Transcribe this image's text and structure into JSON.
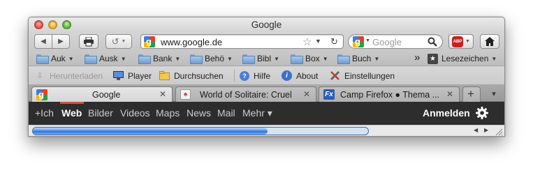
{
  "window": {
    "title": "Google"
  },
  "navbar": {
    "url": "www.google.de",
    "search_placeholder": "Google",
    "adblock_label": "ABP"
  },
  "bookmarks": {
    "items": [
      {
        "label": "Auk"
      },
      {
        "label": "Ausk"
      },
      {
        "label": "Bank"
      },
      {
        "label": "Behö"
      },
      {
        "label": "Bibl"
      },
      {
        "label": "Box"
      },
      {
        "label": "Buch"
      }
    ],
    "overflow": "»",
    "lesezeichen_label": "Lesezeichen"
  },
  "addons": {
    "items": [
      {
        "label": "Herunterladen",
        "enabled": false,
        "icon": "download-icon"
      },
      {
        "label": "Player",
        "enabled": true,
        "icon": "monitor-icon"
      },
      {
        "label": "Durchsuchen",
        "enabled": true,
        "icon": "folder-search-icon"
      },
      {
        "label": "Hilfe",
        "enabled": true,
        "icon": "help-icon"
      },
      {
        "label": "About",
        "enabled": true,
        "icon": "info-icon"
      },
      {
        "label": "Einstellungen",
        "enabled": true,
        "icon": "tools-icon"
      }
    ]
  },
  "tabs": {
    "items": [
      {
        "label": "Google",
        "active": true,
        "icon": "google-favicon"
      },
      {
        "label": "World of Solitaire: Cruel",
        "active": false,
        "icon": "solitaire-favicon"
      },
      {
        "label": "Camp Firefox ● Thema ...",
        "active": false,
        "icon": "firefox-fx-favicon"
      }
    ],
    "new_tab": "+",
    "list_tabs": "▾"
  },
  "google_bar": {
    "links": [
      {
        "label": "+Ich"
      },
      {
        "label": "Web",
        "selected": true
      },
      {
        "label": "Bilder"
      },
      {
        "label": "Videos"
      },
      {
        "label": "Maps"
      },
      {
        "label": "News"
      },
      {
        "label": "Mail"
      },
      {
        "label": "Mehr ▾"
      }
    ],
    "signin": "Anmelden"
  },
  "status": {
    "progress": 0.7
  },
  "colors": {
    "google_bar_bg": "#2d2d2d",
    "progress_blue": "#2d6fd6",
    "close_red": "#ee5b55",
    "minimize_yellow": "#f6b93e",
    "zoom_green": "#69c14b",
    "abp_red": "#c8201f"
  }
}
